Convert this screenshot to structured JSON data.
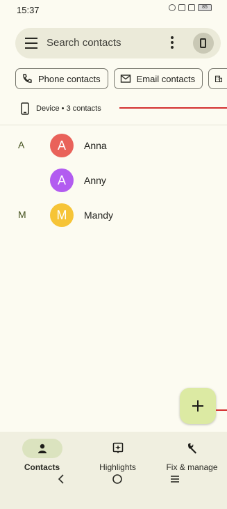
{
  "status_bar": {
    "time": "15:37",
    "battery": "85"
  },
  "search": {
    "placeholder": "Search contacts"
  },
  "filter_chips": [
    {
      "label": "Phone contacts",
      "icon": "phone-icon"
    },
    {
      "label": "Email contacts",
      "icon": "email-icon"
    },
    {
      "label": "",
      "icon": "building-icon"
    }
  ],
  "device_label": "Device • 3 contacts",
  "contacts": [
    {
      "section": "A",
      "initial": "A",
      "name": "Anna",
      "color": "#e9625a"
    },
    {
      "section": "",
      "initial": "A",
      "name": "Anny",
      "color": "#b25cf0"
    },
    {
      "section": "M",
      "initial": "M",
      "name": "Mandy",
      "color": "#f6c437"
    }
  ],
  "bottom_nav": [
    {
      "label": "Contacts",
      "icon": "person-icon",
      "active": true
    },
    {
      "label": "Highlights",
      "icon": "highlights-icon",
      "active": false
    },
    {
      "label": "Fix & manage",
      "icon": "wrench-icon",
      "active": false
    }
  ],
  "colors": {
    "background": "#fcfbf1",
    "fab": "#dceaa3",
    "accent_line": "#d32f2f"
  }
}
